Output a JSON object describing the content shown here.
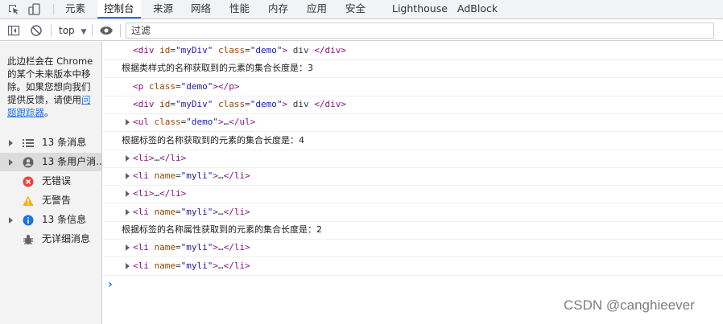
{
  "tabs": [
    "元素",
    "控制台",
    "来源",
    "网络",
    "性能",
    "内存",
    "应用",
    "安全",
    "Lighthouse",
    "AdBlock"
  ],
  "toolbar": {
    "context": "top",
    "filter_placeholder": "过滤"
  },
  "sidebar": {
    "notice_text": "此边栏会在 Chrome 的某个未来版本中移除。如果您想向我们提供反馈，请使用",
    "notice_link": "问题跟踪器",
    "notice_end": "。",
    "items": [
      {
        "label": "13 条消息",
        "icon": "list-icon"
      },
      {
        "label": "13 条用户消...",
        "icon": "user-icon"
      },
      {
        "label": "无错误",
        "icon": "error-icon"
      },
      {
        "label": "无警告",
        "icon": "warning-icon"
      },
      {
        "label": "13 条信息",
        "icon": "info-icon"
      },
      {
        "label": "无详细消息",
        "icon": "verbose-icon"
      }
    ]
  },
  "console": {
    "rows": [
      {
        "kind": "code",
        "tag": "div",
        "attrs": [
          [
            "id",
            "\"myDiv\""
          ],
          [
            "class",
            "\"demo\""
          ]
        ],
        "text": " div ",
        "close": "div"
      },
      {
        "kind": "msg",
        "text": "根据类样式的名称获取到的元素的集合长度是：3"
      },
      {
        "kind": "code",
        "tag": "p",
        "attrs": [
          [
            "class",
            "\"demo\""
          ]
        ],
        "text": "",
        "close": "p"
      },
      {
        "kind": "code",
        "tag": "div",
        "attrs": [
          [
            "id",
            "\"myDiv\""
          ],
          [
            "class",
            "\"demo\""
          ]
        ],
        "text": " div ",
        "close": "div"
      },
      {
        "kind": "collapsed",
        "tag": "ul",
        "attrs": [
          [
            "class",
            "\"demo\""
          ]
        ],
        "text": "…",
        "close": "ul"
      },
      {
        "kind": "msg",
        "text": "根据标签的名称获取到的元素的集合长度是：4"
      },
      {
        "kind": "collapsed",
        "tag": "li",
        "attrs": [],
        "text": "…",
        "close": "li"
      },
      {
        "kind": "collapsed",
        "tag": "li",
        "attrs": [
          [
            "name",
            "\"myli\""
          ]
        ],
        "text": "…",
        "close": "li"
      },
      {
        "kind": "collapsed",
        "tag": "li",
        "attrs": [],
        "text": "…",
        "close": "li"
      },
      {
        "kind": "collapsed",
        "tag": "li",
        "attrs": [
          [
            "name",
            "\"myli\""
          ]
        ],
        "text": "…",
        "close": "li"
      },
      {
        "kind": "msg",
        "text": "根据标签的名称属性获取到的元素的集合长度是：2"
      },
      {
        "kind": "collapsed",
        "tag": "li",
        "attrs": [
          [
            "name",
            "\"myli\""
          ]
        ],
        "text": "…",
        "close": "li"
      },
      {
        "kind": "collapsed",
        "tag": "li",
        "attrs": [
          [
            "name",
            "\"myli\""
          ]
        ],
        "text": "…",
        "close": "li"
      }
    ],
    "prompt": "›"
  },
  "watermark": "CSDN @canghieever",
  "colors": {
    "accent": "#1a73e8",
    "tag": "#881280",
    "attr_name": "#994500",
    "attr_value": "#1a1aa6"
  }
}
